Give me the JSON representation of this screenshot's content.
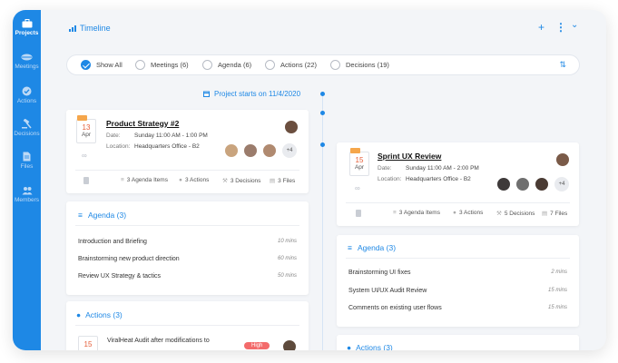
{
  "sidebar": {
    "items": [
      {
        "label": "Projects",
        "icon": "briefcase-icon",
        "active": true
      },
      {
        "label": "Meetings",
        "icon": "meetings-icon"
      },
      {
        "label": "Actions",
        "icon": "check-circle-icon"
      },
      {
        "label": "Decisions",
        "icon": "gavel-icon"
      },
      {
        "label": "Files",
        "icon": "file-icon"
      },
      {
        "label": "Members",
        "icon": "members-icon"
      }
    ]
  },
  "header": {
    "title": "Timeline",
    "add_label": "+",
    "menu_label": "⋮",
    "chevron_label": "⌄"
  },
  "filters": [
    {
      "label": "Show All",
      "checked": true
    },
    {
      "label": "Meetings (6)",
      "checked": false
    },
    {
      "label": "Agenda (6)",
      "checked": false
    },
    {
      "label": "Actions (22)",
      "checked": false
    },
    {
      "label": "Decisions (19)",
      "checked": false
    }
  ],
  "sort_label": "⇅",
  "project_start": "Project starts on 11/4/2020",
  "meetings": [
    {
      "day": "13",
      "month": "Apr",
      "title": "Product Strategy #2",
      "date_label": "Date:",
      "date": "Sunday 11:00 AM - 1:00 PM",
      "location_label": "Location:",
      "location": "Headquarters Office - B2",
      "more": "+4",
      "stats": {
        "agenda": "3 Agenda Items",
        "actions": "3 Actions",
        "decisions": "3 Decisions",
        "files": "3 Files"
      },
      "agenda_title": "Agenda (3)",
      "agenda": [
        {
          "label": "Introduction and Briefing",
          "duration": "10 mins"
        },
        {
          "label": "Brainstorming new product direction",
          "duration": "60 mins"
        },
        {
          "label": "Review UX Strategy & tactics",
          "duration": "50 mins"
        }
      ],
      "actions_title": "Actions (3)",
      "action_item": {
        "day": "15",
        "label": "ViralHeat Audit after modifications to",
        "priority": "High"
      }
    },
    {
      "day": "15",
      "month": "Apr",
      "title": "Sprint UX Review",
      "date_label": "Date:",
      "date": "Sunday 11:00 AM - 2:00 PM",
      "location_label": "Location:",
      "location": "Headquarters Office - B2",
      "more": "+4",
      "stats": {
        "agenda": "3 Agenda Items",
        "actions": "3 Actions",
        "decisions": "5 Decisions",
        "files": "7 Files"
      },
      "agenda_title": "Agenda (3)",
      "agenda": [
        {
          "label": "Brainstorming UI fixes",
          "duration": "2 mins"
        },
        {
          "label": "System UI/UX Audit Review",
          "duration": "15 mins"
        },
        {
          "label": "Comments on existing user flows",
          "duration": "15 mins"
        }
      ],
      "actions_title": "Actions (3)"
    }
  ],
  "colors": {
    "accent": "#1e88e5",
    "date_tab": "#f5a64b",
    "high": "#f36b6b"
  }
}
